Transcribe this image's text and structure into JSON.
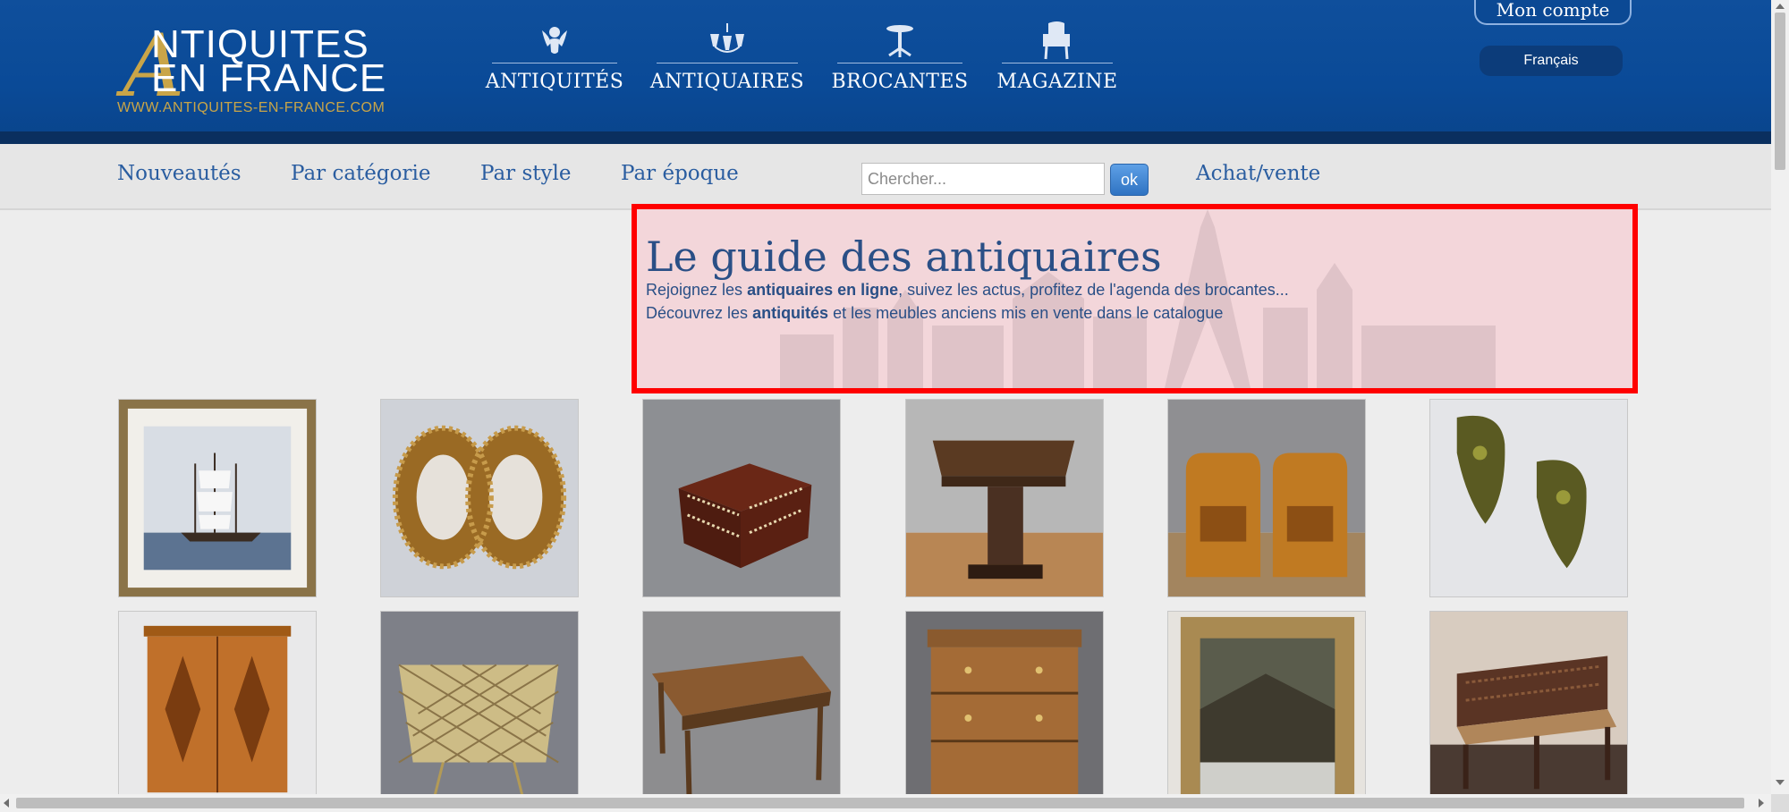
{
  "logo": {
    "big_letter": "A",
    "line1": "NTIQUITES",
    "line2": "EN FRANCE",
    "url": "WWW.ANTIQUITES-EN-FRANCE.COM",
    "gold_color": "#c9a548"
  },
  "main_nav": [
    {
      "label": "ANTIQUITÉS",
      "icon": "cherub-icon"
    },
    {
      "label": "ANTIQUAIRES",
      "icon": "chandelier-icon"
    },
    {
      "label": "BROCANTES",
      "icon": "pedestal-table-icon"
    },
    {
      "label": "MAGAZINE",
      "icon": "armchair-icon"
    }
  ],
  "account": {
    "label": "Mon compte"
  },
  "language": {
    "label": "Français"
  },
  "sub_nav": [
    {
      "label": "Nouveautés"
    },
    {
      "label": "Par catégorie"
    },
    {
      "label": "Par style"
    },
    {
      "label": "Par époque"
    },
    {
      "label": "Achat/vente"
    }
  ],
  "search": {
    "placeholder": "Chercher...",
    "button_label": "ok"
  },
  "hero": {
    "title": "Le guide des antiquaires",
    "line1_pre": "Rejoignez les ",
    "line1_bold": "antiquaires en ligne",
    "line1_post": ", suivez les actus, profitez de l'agenda des brocantes...",
    "line2_pre": "Découvrez les ",
    "line2_bold": "antiquités",
    "line2_post": " et les meubles anciens mis en vente dans le catalogue",
    "highlight_color": "#ff0000"
  },
  "colors": {
    "header_blue": "#0f4f9c",
    "link_blue": "#2a5da0",
    "hero_text": "#2a4f86"
  }
}
